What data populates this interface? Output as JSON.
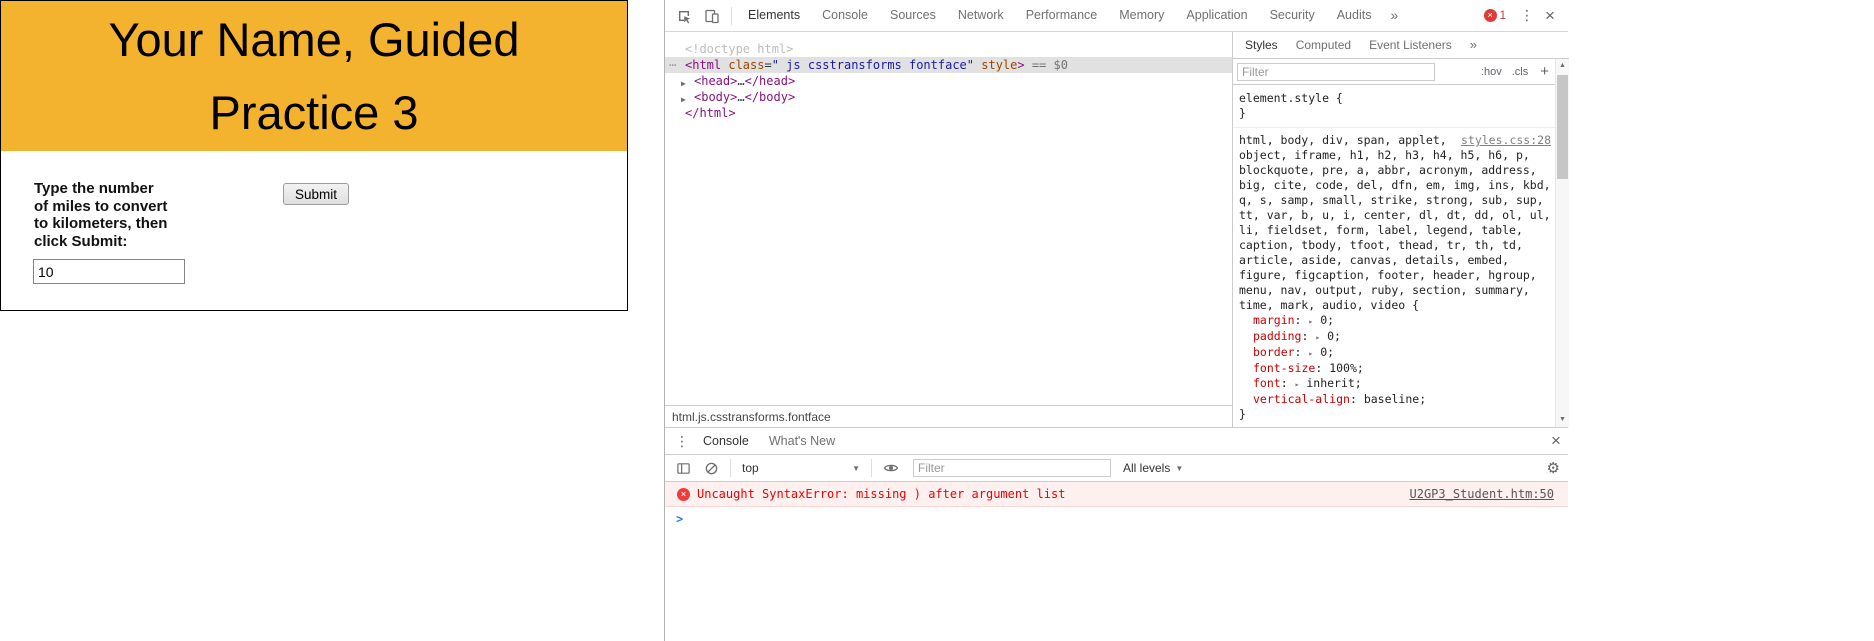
{
  "colors": {
    "banner": "#f4b32e",
    "error_text": "#ee0000",
    "selection": "#e1e1e1"
  },
  "page": {
    "title": "Your Name, Guided Practice 3",
    "instructions": [
      "Type the number",
      "of miles to convert",
      "to kilometers, then",
      "click Submit:"
    ],
    "submit_label": "Submit",
    "miles_value": "10"
  },
  "devtools": {
    "glyphs": {
      "kebab": "⋮",
      "close": "×",
      "more": "»",
      "dropdown": "▼",
      "scroll_up": "▲",
      "scroll_down": "▼",
      "expand": "▶",
      "expand_small": "▸",
      "gear": "⚙",
      "plus": "+",
      "badge_x": "×",
      "prompt": ">"
    },
    "toolbar": {
      "tabs": [
        "Elements",
        "Console",
        "Sources",
        "Network",
        "Performance",
        "Memory",
        "Application",
        "Security",
        "Audits"
      ],
      "error_count": "1"
    },
    "elements": {
      "doctype": "<!doctype html>",
      "html_line": {
        "gutter": "⋯",
        "tag_open": "<html",
        "attr_class_name": " class",
        "attr_eq": "=",
        "attr_class_value": "\" js csstransforms fontface\"",
        "attr_style_name": " style",
        "tag_close": ">",
        "hint": " == $0"
      },
      "head_line": {
        "open": "<head>",
        "dots": "…",
        "close": "</head>"
      },
      "body_line": {
        "open": "<body>",
        "dots": "…",
        "close": "</body>"
      },
      "html_close": "</html>",
      "statusbar": "html.js.csstransforms.fontface"
    },
    "styles": {
      "tabs": [
        "Styles",
        "Computed",
        "Event Listeners"
      ],
      "filter_placeholder": "Filter",
      "pseudo_toggle": ":hov",
      "class_toggle": ".cls",
      "element_style_open": "element.style {",
      "close_brace": "}",
      "punct_colon": ":",
      "rule": {
        "selector": "html, body, div, span, applet, object, iframe, h1, h2, h3, h4, h5, h6, p, blockquote, pre, a, abbr, acronym, address, big, cite, code, del, dfn, em, img, ins, kbd, q, s, samp, small, strike, strong, sub, sup, tt, var, b, u, i, center, dl, dt, dd, ol, ul, li, fieldset, form, label, legend, table, caption, tbody, tfoot, thead, tr, th, td, article, aside, canvas, details, embed, figure, figcaption, footer, header, hgroup, menu, nav, output, ruby, section, summary, time, mark, audio, video {",
        "source": "styles.css:28",
        "properties": [
          {
            "name": "margin",
            "value": "0;"
          },
          {
            "name": "padding",
            "value": "0;"
          },
          {
            "name": "border",
            "value": "0;"
          },
          {
            "name": "font-size",
            "value": "100%;"
          },
          {
            "name": "font",
            "value": "inherit;"
          },
          {
            "name": "vertical-align",
            "value": "baseline;"
          }
        ]
      }
    },
    "console": {
      "tabs": [
        "Console",
        "What's New"
      ],
      "context_selector": "top",
      "filter_placeholder": "Filter",
      "level_filter": "All levels",
      "error_message": "Uncaught SyntaxError: missing ) after argument list",
      "error_source": "U2GP3_Student.htm:50"
    }
  }
}
